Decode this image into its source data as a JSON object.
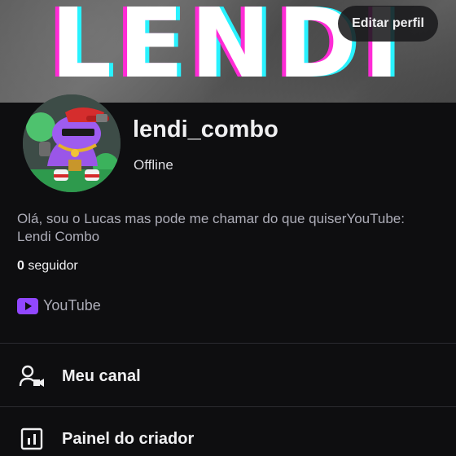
{
  "banner": {
    "text": "LENDI"
  },
  "header": {
    "edit_profile_label": "Editar perfil"
  },
  "profile": {
    "username": "lendi_combo",
    "status": "Offline",
    "bio": "Olá, sou o Lucas mas pode me chamar do que quiserYouTube: Lendi Combo",
    "followers_count": "0",
    "followers_label": "seguidor"
  },
  "social_links": [
    {
      "label": "YouTube",
      "icon": "youtube-icon",
      "color": "#9147ff"
    }
  ],
  "menu": [
    {
      "label": "Meu canal",
      "icon": "person-camera-icon"
    },
    {
      "label": "Painel do criador",
      "icon": "dashboard-chart-icon"
    }
  ],
  "colors": {
    "background": "#0e0e10",
    "accent": "#9147ff",
    "text_primary": "#efeff1",
    "text_secondary": "#adadb8"
  }
}
